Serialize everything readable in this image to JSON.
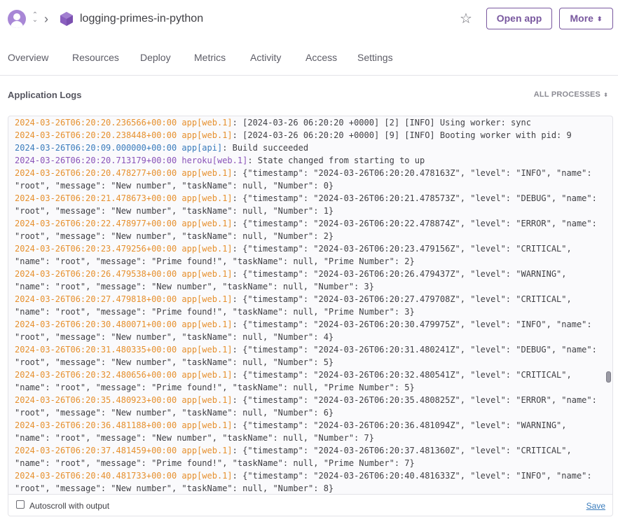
{
  "header": {
    "app_name": "logging-primes-in-python",
    "open_app_label": "Open app",
    "more_label": "More"
  },
  "tabs": [
    {
      "label": "Overview"
    },
    {
      "label": "Resources"
    },
    {
      "label": "Deploy"
    },
    {
      "label": "Metrics"
    },
    {
      "label": "Activity"
    },
    {
      "label": "Access"
    },
    {
      "label": "Settings"
    }
  ],
  "logs": {
    "title": "Application Logs",
    "processes_label": "ALL PROCESSES",
    "autoscroll_label": "Autoscroll with output",
    "save_label": "Save",
    "lines": [
      {
        "ts": "2024-03-26T06:20:20.236566+00:00 app[web.1]",
        "kind": "app",
        "text": ": [2024-03-26 06:20:20 +0000] [2] [INFO] Using worker: sync"
      },
      {
        "ts": "2024-03-26T06:20:20.238448+00:00 app[web.1]",
        "kind": "app",
        "text": ": [2024-03-26 06:20:20 +0000] [9] [INFO] Booting worker with pid: 9"
      },
      {
        "ts": "2024-03-26T06:20:09.000000+00:00 app[api]",
        "kind": "api",
        "text": ": Build succeeded"
      },
      {
        "ts": "2024-03-26T06:20:20.713179+00:00 heroku[web.1]",
        "kind": "heroku",
        "text": ": State changed from starting to up"
      },
      {
        "ts": "2024-03-26T06:20:20.478277+00:00 app[web.1]",
        "kind": "app",
        "text": ": {\"timestamp\": \"2024-03-26T06:20:20.478163Z\", \"level\": \"INFO\", \"name\":",
        "cont": "\"root\", \"message\": \"New number\", \"taskName\": null, \"Number\": 0}"
      },
      {
        "ts": "2024-03-26T06:20:21.478673+00:00 app[web.1]",
        "kind": "app",
        "text": ": {\"timestamp\": \"2024-03-26T06:20:21.478573Z\", \"level\": \"DEBUG\", \"name\":",
        "cont": "\"root\", \"message\": \"New number\", \"taskName\": null, \"Number\": 1}"
      },
      {
        "ts": "2024-03-26T06:20:22.478977+00:00 app[web.1]",
        "kind": "app",
        "text": ": {\"timestamp\": \"2024-03-26T06:20:22.478874Z\", \"level\": \"ERROR\", \"name\":",
        "cont": "\"root\", \"message\": \"New number\", \"taskName\": null, \"Number\": 2}"
      },
      {
        "ts": "2024-03-26T06:20:23.479256+00:00 app[web.1]",
        "kind": "app",
        "text": ": {\"timestamp\": \"2024-03-26T06:20:23.479156Z\", \"level\": \"CRITICAL\",",
        "cont": "\"name\": \"root\", \"message\": \"Prime found!\", \"taskName\": null, \"Prime Number\": 2}"
      },
      {
        "ts": "2024-03-26T06:20:26.479538+00:00 app[web.1]",
        "kind": "app",
        "text": ": {\"timestamp\": \"2024-03-26T06:20:26.479437Z\", \"level\": \"WARNING\",",
        "cont": "\"name\": \"root\", \"message\": \"New number\", \"taskName\": null, \"Number\": 3}"
      },
      {
        "ts": "2024-03-26T06:20:27.479818+00:00 app[web.1]",
        "kind": "app",
        "text": ": {\"timestamp\": \"2024-03-26T06:20:27.479708Z\", \"level\": \"CRITICAL\",",
        "cont": "\"name\": \"root\", \"message\": \"Prime found!\", \"taskName\": null, \"Prime Number\": 3}"
      },
      {
        "ts": "2024-03-26T06:20:30.480071+00:00 app[web.1]",
        "kind": "app",
        "text": ": {\"timestamp\": \"2024-03-26T06:20:30.479975Z\", \"level\": \"INFO\", \"name\":",
        "cont": "\"root\", \"message\": \"New number\", \"taskName\": null, \"Number\": 4}"
      },
      {
        "ts": "2024-03-26T06:20:31.480335+00:00 app[web.1]",
        "kind": "app",
        "text": ": {\"timestamp\": \"2024-03-26T06:20:31.480241Z\", \"level\": \"DEBUG\", \"name\":",
        "cont": "\"root\", \"message\": \"New number\", \"taskName\": null, \"Number\": 5}"
      },
      {
        "ts": "2024-03-26T06:20:32.480656+00:00 app[web.1]",
        "kind": "app",
        "text": ": {\"timestamp\": \"2024-03-26T06:20:32.480541Z\", \"level\": \"CRITICAL\",",
        "cont": "\"name\": \"root\", \"message\": \"Prime found!\", \"taskName\": null, \"Prime Number\": 5}"
      },
      {
        "ts": "2024-03-26T06:20:35.480923+00:00 app[web.1]",
        "kind": "app",
        "text": ": {\"timestamp\": \"2024-03-26T06:20:35.480825Z\", \"level\": \"ERROR\", \"name\":",
        "cont": "\"root\", \"message\": \"New number\", \"taskName\": null, \"Number\": 6}"
      },
      {
        "ts": "2024-03-26T06:20:36.481188+00:00 app[web.1]",
        "kind": "app",
        "text": ": {\"timestamp\": \"2024-03-26T06:20:36.481094Z\", \"level\": \"WARNING\",",
        "cont": "\"name\": \"root\", \"message\": \"New number\", \"taskName\": null, \"Number\": 7}"
      },
      {
        "ts": "2024-03-26T06:20:37.481459+00:00 app[web.1]",
        "kind": "app",
        "text": ": {\"timestamp\": \"2024-03-26T06:20:37.481360Z\", \"level\": \"CRITICAL\",",
        "cont": "\"name\": \"root\", \"message\": \"Prime found!\", \"taskName\": null, \"Prime Number\": 7}"
      },
      {
        "ts": "2024-03-26T06:20:40.481733+00:00 app[web.1]",
        "kind": "app",
        "text": ": {\"timestamp\": \"2024-03-26T06:20:40.481633Z\", \"level\": \"INFO\", \"name\":",
        "cont": "\"root\", \"message\": \"New number\", \"taskName\": null, \"Number\": 8}"
      }
    ]
  },
  "colors": {
    "accent": "#79589f",
    "timestamp_app": "#e6902e",
    "timestamp_api": "#3a7cbc",
    "timestamp_heroku": "#8a54b9"
  }
}
